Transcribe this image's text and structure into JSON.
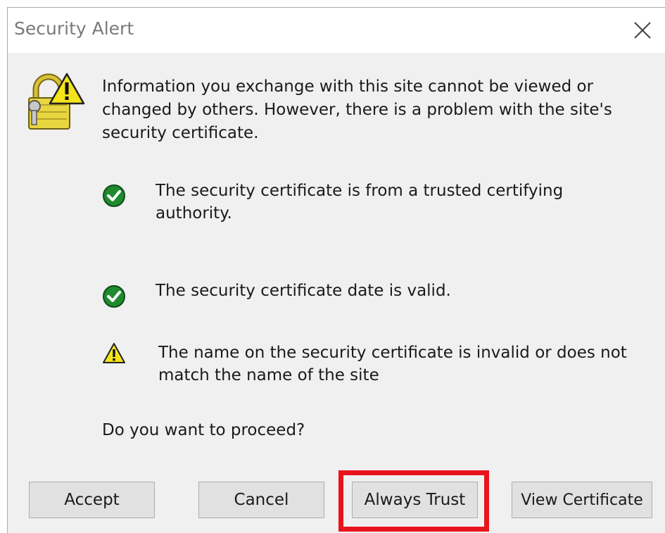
{
  "window": {
    "title": "Security Alert",
    "close_icon": "close-icon"
  },
  "message": {
    "intro": "Information you exchange with this site cannot be viewed or changed by others. However, there is a problem with the site's security certificate.",
    "icon": "padlock-warning-icon"
  },
  "checks": [
    {
      "status": "ok",
      "icon": "green-check-icon",
      "text": "The security certificate is from a trusted certifying authority."
    },
    {
      "status": "ok",
      "icon": "green-check-icon",
      "text": "The security certificate date is valid."
    },
    {
      "status": "warning",
      "icon": "warning-triangle-icon",
      "text": "The name on the security certificate is invalid or does not match the name of the site"
    }
  ],
  "prompt": "Do you want to proceed?",
  "buttons": {
    "accept": "Accept",
    "cancel": "Cancel",
    "always_trust": "Always Trust",
    "view_certificate": "View Certificate"
  },
  "colors": {
    "highlight": "#e8141c",
    "ok": "#1f8a2e",
    "warning": "#f5e31a",
    "dialog_bg": "#f0f0f0"
  }
}
